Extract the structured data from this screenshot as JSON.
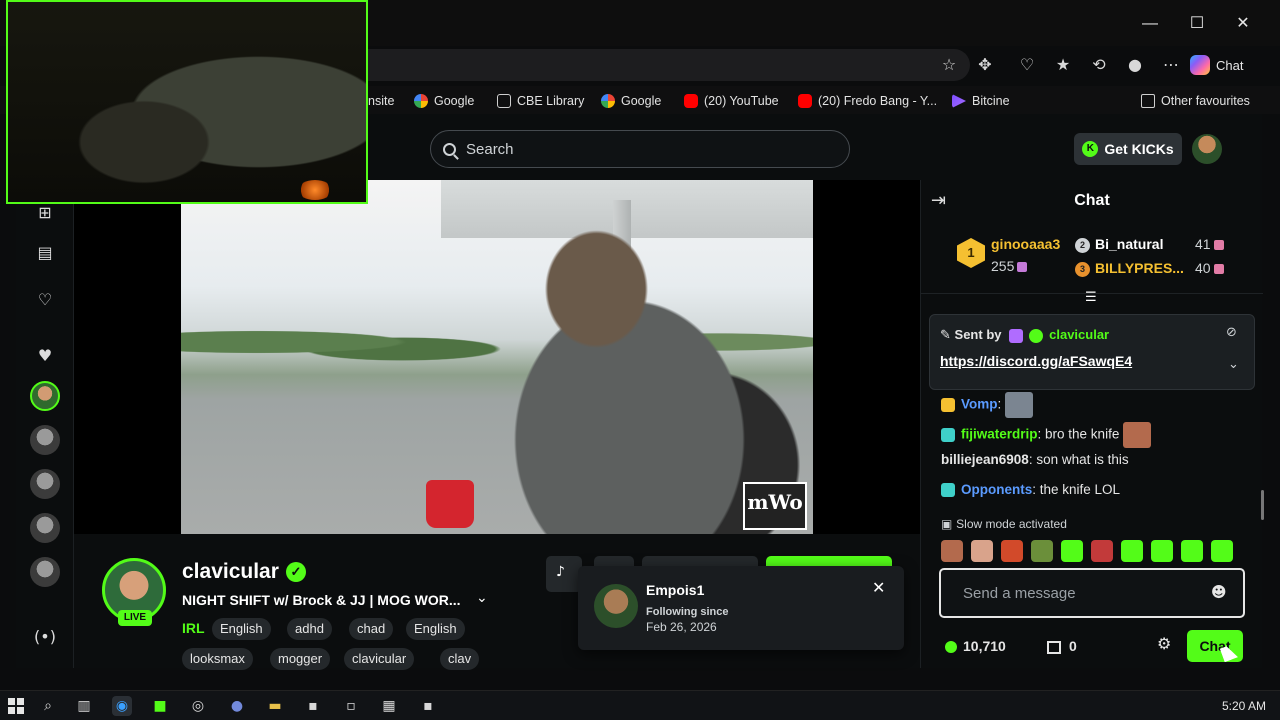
{
  "browser": {
    "window_controls": {
      "minimize": "—",
      "maximize": "☐",
      "close": "✕"
    },
    "copilot_label": "Chat",
    "bookmarks": [
      {
        "label": "nsite",
        "icon": "site-icon"
      },
      {
        "label": "Google",
        "icon": "google-icon"
      },
      {
        "label": "CBE Library",
        "icon": "library-icon"
      },
      {
        "label": "Google",
        "icon": "google-icon"
      },
      {
        "label": "(20) YouTube",
        "icon": "youtube-icon"
      },
      {
        "label": "(20) Fredo Bang - Y...",
        "icon": "youtube-icon"
      },
      {
        "label": "Bitcine",
        "icon": "bitcine-icon"
      }
    ],
    "other_favourites": "Other favourites"
  },
  "kick": {
    "search_placeholder": "Search",
    "get_kicks_label": "Get KICKs",
    "accent": "#53fc18"
  },
  "stream": {
    "streamer": "clavicular",
    "live_badge": "LIVE",
    "title": "NIGHT SHIFT w/ Brock & JJ | MOG WOR...",
    "category": "IRL",
    "tags": [
      "English",
      "adhd",
      "chad",
      "English",
      "looksmax",
      "mogger",
      "clavicular",
      "clav"
    ],
    "watermark": "mWo"
  },
  "follow_popup": {
    "name": "Empois1",
    "following_since_label": "Following since",
    "date": "Feb 26, 2026"
  },
  "chat": {
    "title": "Chat",
    "leaderboard": {
      "first": {
        "rank": "1",
        "user": "ginooaaa3",
        "amount": "255"
      },
      "second": {
        "rank": "2",
        "user": "Bi_natural",
        "amount": "41"
      },
      "third": {
        "rank": "3",
        "user": "BILLYPRES...",
        "amount": "40"
      }
    },
    "pinned": {
      "sent_by_label": "Sent by",
      "sender": "clavicular",
      "link": "https://discord.gg/aFSawqE4"
    },
    "messages": [
      {
        "user": "Vomp",
        "text": "",
        "color": "#5b9bff"
      },
      {
        "user": "fijiwaterdrip",
        "text": "bro the knife",
        "color": "#53fc18"
      },
      {
        "user": "billiejean6908",
        "text": "son what is this",
        "color": "#e6e6e6"
      },
      {
        "user": "Opponents",
        "text": "the knife LOL",
        "color": "#5b9bff"
      }
    ],
    "slow_mode": "Slow mode activated",
    "input_placeholder": "Send a message",
    "points": "10,710",
    "store_count": "0",
    "send_label": "Chat"
  },
  "taskbar": {
    "clock": "5:20 AM"
  }
}
